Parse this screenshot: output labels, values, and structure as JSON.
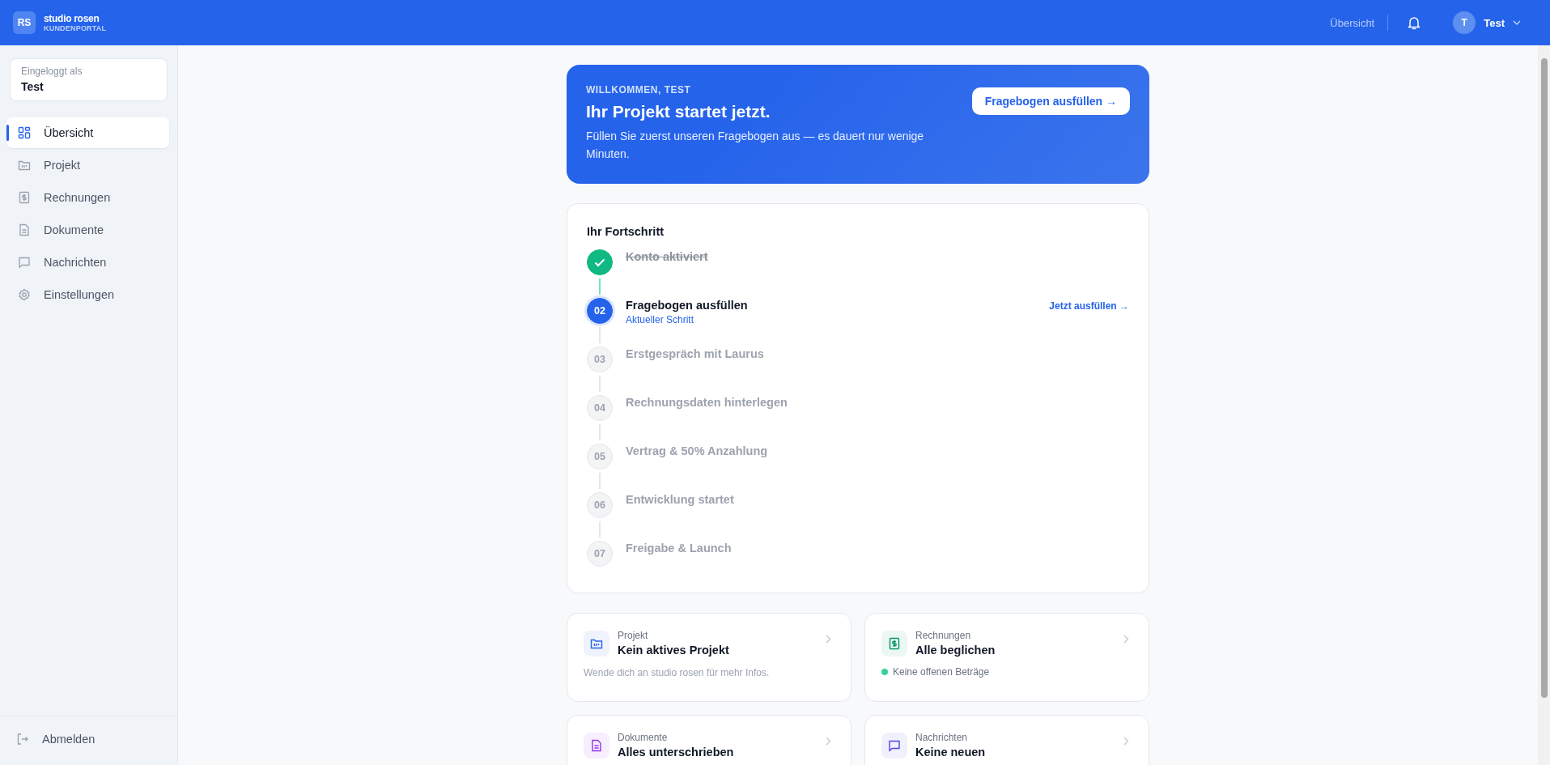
{
  "header": {
    "logo": "RS",
    "brand": "studio rosen",
    "subtitle": "KUNDENPORTAL",
    "nav_link": "Übersicht",
    "user_initial": "T",
    "user_name": "Test"
  },
  "sidebar": {
    "login_label": "Eingeloggt als",
    "login_name": "Test",
    "items": [
      {
        "label": "Übersicht",
        "selected": true
      },
      {
        "label": "Projekt",
        "selected": false
      },
      {
        "label": "Rechnungen",
        "selected": false
      },
      {
        "label": "Dokumente",
        "selected": false
      },
      {
        "label": "Nachrichten",
        "selected": false
      },
      {
        "label": "Einstellungen",
        "selected": false
      }
    ],
    "logout": "Abmelden"
  },
  "hero": {
    "eyebrow": "WILLKOMMEN, TEST",
    "title": "Ihr Projekt startet jetzt.",
    "text": "Füllen Sie zuerst unseren Fragebogen aus — es dauert nur wenige Minuten.",
    "button": "Fragebogen ausfüllen →"
  },
  "progress": {
    "title": "Ihr Fortschritt",
    "steps": [
      {
        "done": true,
        "current": false,
        "label": "Konto aktiviert"
      },
      {
        "done": false,
        "current": true,
        "number": "02",
        "label": "Fragebogen ausfüllen",
        "subtitle": "Aktueller Schritt",
        "action": "Jetzt ausfüllen →"
      },
      {
        "done": false,
        "current": false,
        "number": "03",
        "label": "Erstgespräch mit Laurus"
      },
      {
        "done": false,
        "current": false,
        "number": "04",
        "label": "Rechnungsdaten hinterlegen"
      },
      {
        "done": false,
        "current": false,
        "number": "05",
        "label": "Vertrag & 50% Anzahlung"
      },
      {
        "done": false,
        "current": false,
        "number": "06",
        "label": "Entwicklung startet"
      },
      {
        "done": false,
        "current": false,
        "number": "07",
        "label": "Freigabe & Launch"
      }
    ]
  },
  "cards": [
    {
      "kind": "folder",
      "color": "#2563eb",
      "label": "Projekt",
      "title": "Kein aktives Projekt",
      "note": "Wende dich an studio rosen für mehr Infos."
    },
    {
      "kind": "invoice",
      "color": "#059669",
      "label": "Rechnungen",
      "title": "Alle beglichen",
      "status": {
        "text": "Keine offenen Beträge",
        "color": "#34d399"
      }
    },
    {
      "kind": "document",
      "color": "#9333ea",
      "label": "Dokumente",
      "title": "Alles unterschrieben"
    },
    {
      "kind": "message",
      "color": "#4f46e5",
      "label": "Nachrichten",
      "title": "Keine neuen"
    }
  ]
}
